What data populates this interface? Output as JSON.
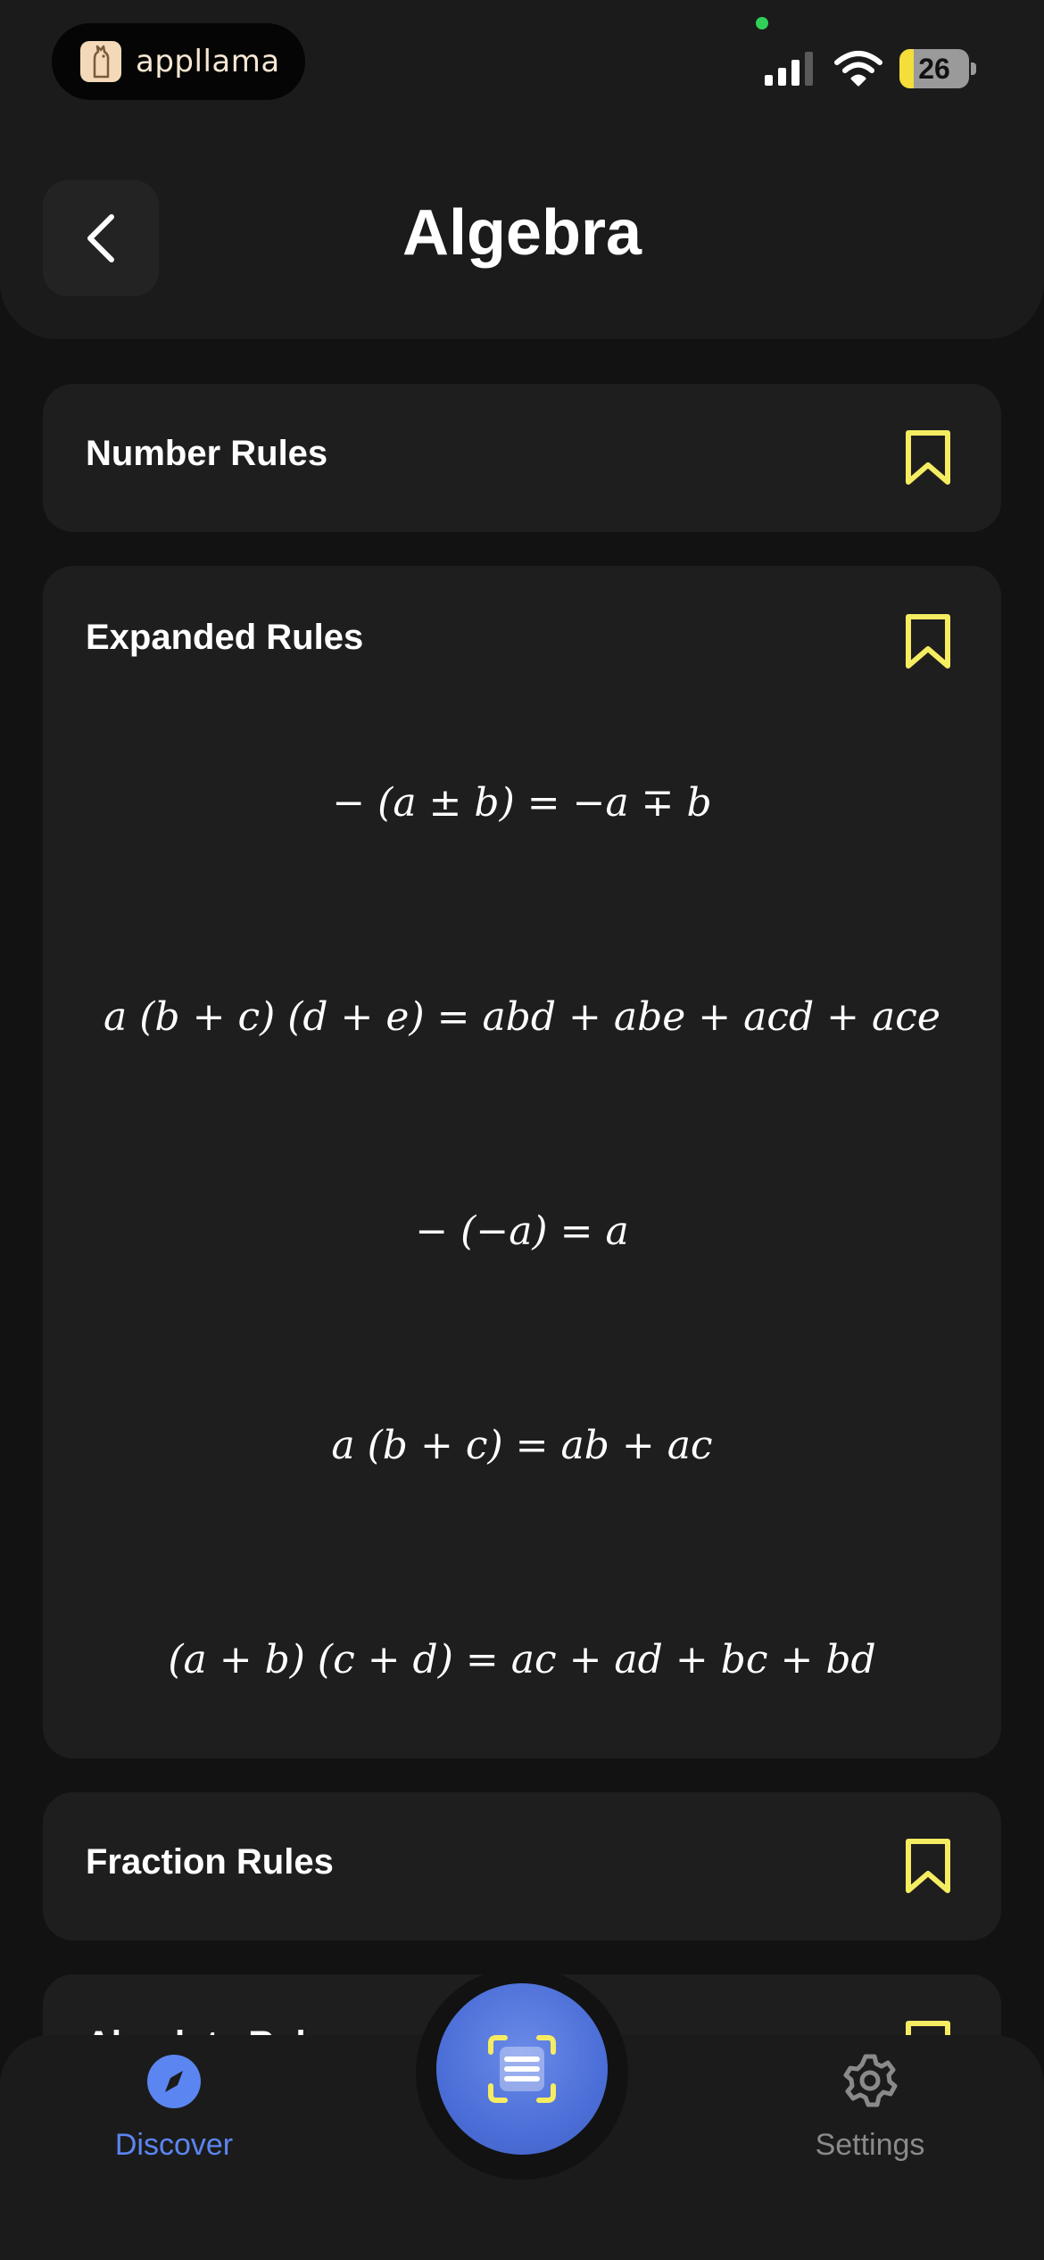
{
  "status_bar": {
    "app_name": "appllama",
    "battery_level": "26",
    "battery_percent": 26,
    "camera_indicator_color": "#2fd158"
  },
  "header": {
    "title": "Algebra",
    "back_icon": "chevron-left-icon"
  },
  "sections": [
    {
      "title": "Number Rules",
      "bookmark_icon": "bookmark-icon",
      "expanded": false
    },
    {
      "title": "Expanded Rules",
      "bookmark_icon": "bookmark-icon",
      "expanded": true,
      "formulas": [
        "− (a ± b) = −a ∓ b",
        "a (b + c) (d + e) = abd + abe + acd + ace",
        "− (−a) = a",
        "a (b + c) = ab + ac",
        "(a + b) (c + d) = ac + ad + bc + bd"
      ]
    },
    {
      "title": "Fraction Rules",
      "bookmark_icon": "bookmark-icon",
      "expanded": false
    },
    {
      "title": "Absolute Rules",
      "bookmark_icon": "bookmark-icon",
      "expanded": false
    }
  ],
  "tab_bar": {
    "discover_label": "Discover",
    "settings_label": "Settings",
    "scan_icon": "scan-document-icon"
  },
  "colors": {
    "accent_blue": "#5b85f0",
    "bookmark_yellow": "#f5ec62",
    "inactive_gray": "#8a8a8a",
    "card_bg": "#1e1e1e",
    "page_bg": "#121212"
  }
}
